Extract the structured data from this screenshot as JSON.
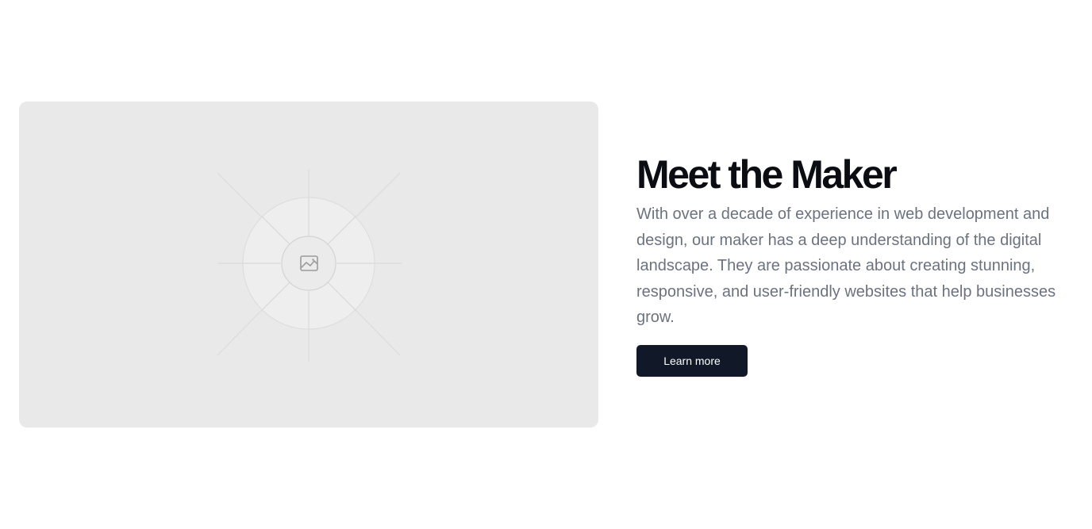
{
  "hero": {
    "image_icon": "image-placeholder-icon",
    "title": "Meet the Maker",
    "description": "With over a decade of experience in web development and design, our maker has a deep understanding of the digital landscape. They are passionate about creating stunning, responsive, and user-friendly websites that help businesses grow.",
    "cta_label": "Learn more"
  },
  "colors": {
    "card_background": "#e9e9e9",
    "title": "#0b0d12",
    "body_text": "#6b7280",
    "button_background": "#111827",
    "button_text": "#ffffff"
  }
}
